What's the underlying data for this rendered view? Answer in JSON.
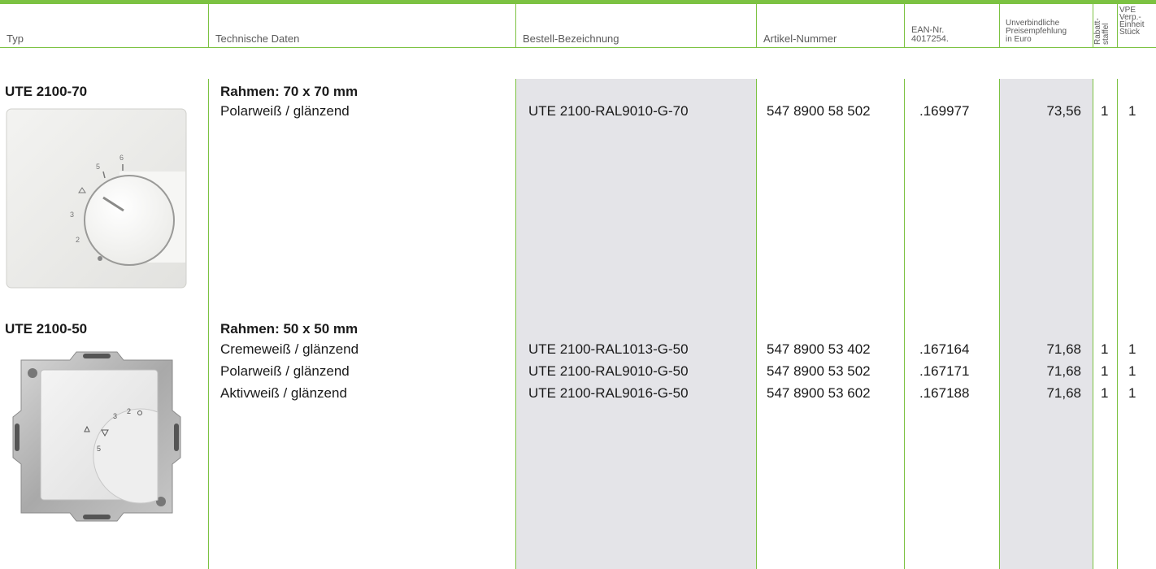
{
  "columns": {
    "typ": "Typ",
    "technische_daten": "Technische Daten",
    "bestell_bezeichnung": "Bestell-Bezeichnung",
    "artikel_nummer": "Artikel-Nummer",
    "ean": "EAN-Nr.\n4017254.",
    "preis": "Unverbindliche\nPreisempfehlung\nin Euro",
    "rabatt": "Rabatt-\nstaffel",
    "vpe": "VPE\nVerp.-\nEinheit\nStück"
  },
  "products": [
    {
      "type": "UTE 2100-70",
      "spec_title": "Rahmen: 70 x 70 mm",
      "image_icon": "thermostat-70-icon",
      "variants": [
        {
          "spec": "Polarweiß / glänzend",
          "order": "UTE 2100-RAL9010-G-70",
          "article": "547 8900 58 502",
          "ean": ".169977",
          "price": "73,56",
          "rabatt": "1",
          "vpe": "1"
        }
      ]
    },
    {
      "type": "UTE 2100-50",
      "spec_title": "Rahmen: 50 x 50 mm",
      "image_icon": "thermostat-50-icon",
      "variants": [
        {
          "spec": "Cremeweiß / glänzend",
          "order": "UTE 2100-RAL1013-G-50",
          "article": "547 8900 53 402",
          "ean": ".167164",
          "price": "71,68",
          "rabatt": "1",
          "vpe": "1"
        },
        {
          "spec": "Polarweiß / glänzend",
          "order": "UTE 2100-RAL9010-G-50",
          "article": "547 8900 53 502",
          "ean": ".167171",
          "price": "71,68",
          "rabatt": "1",
          "vpe": "1"
        },
        {
          "spec": "Aktivweiß / glänzend",
          "order": "UTE 2100-RAL9016-G-50",
          "article": "547 8900 53 602",
          "ean": ".167188",
          "price": "71,68",
          "rabatt": "1",
          "vpe": "1"
        }
      ]
    }
  ],
  "dial_labels_70": [
    "5",
    "6",
    "3",
    "2"
  ],
  "dial_labels_50": [
    "2",
    "3",
    "5"
  ],
  "colors": {
    "accent": "#7cc242",
    "shade": "#e4e4e8"
  }
}
